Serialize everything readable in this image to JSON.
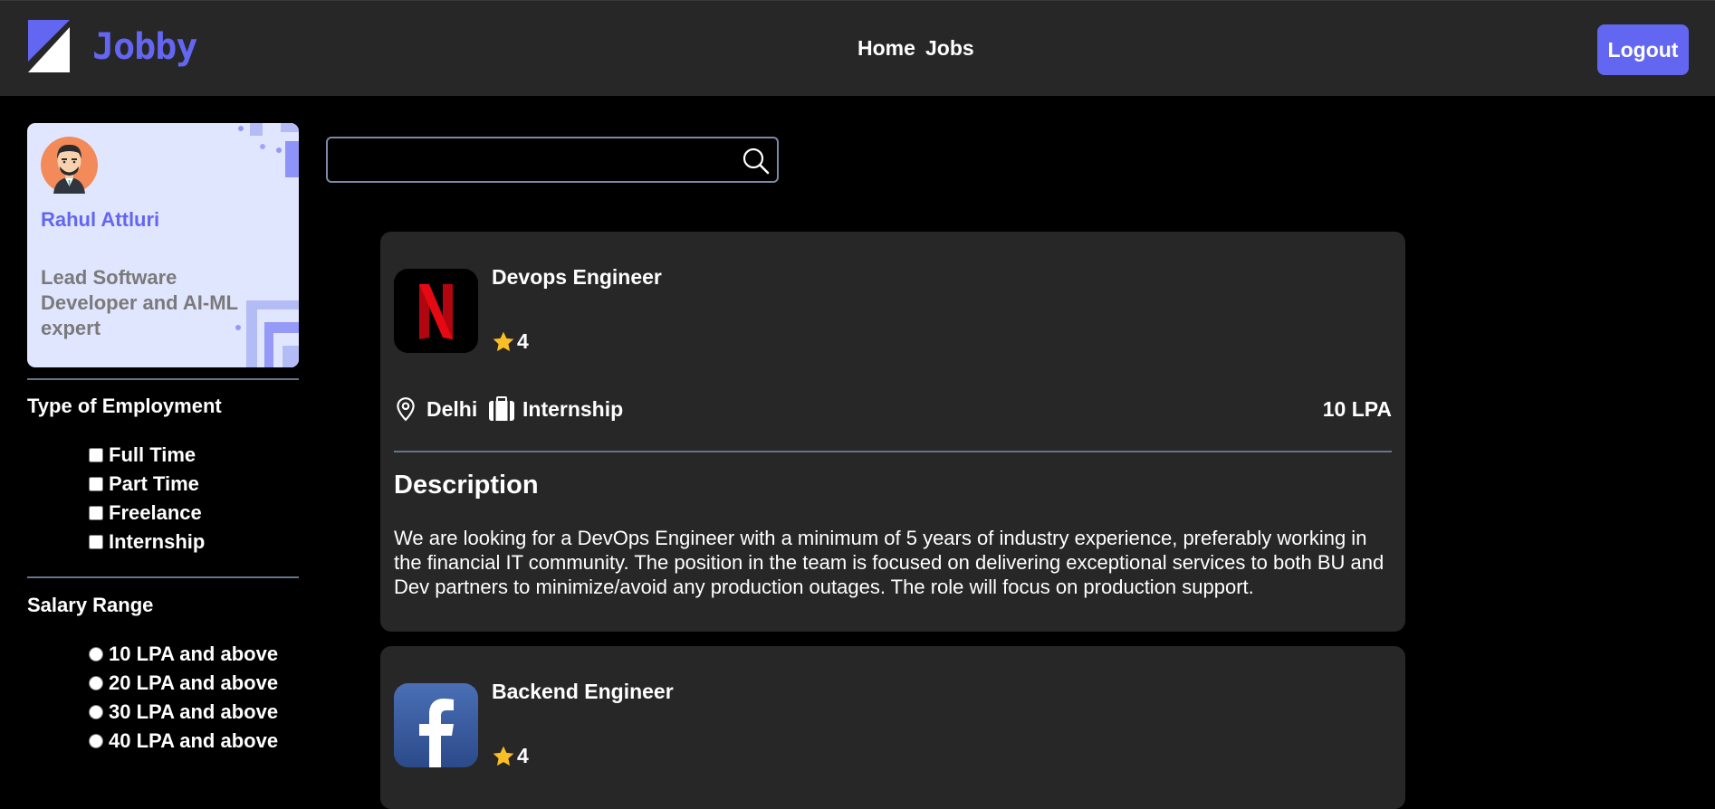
{
  "app": {
    "brand": "Jobby",
    "nav": {
      "home": "Home",
      "jobs": "Jobs"
    },
    "logout_label": "Logout",
    "accent_color": "#6366f1"
  },
  "profile": {
    "name": "Rahul Attluri",
    "bio": "Lead Software Developer and AI-ML expert"
  },
  "filters": {
    "employment_title": "Type of Employment",
    "employment_options": [
      {
        "label": "Full Time",
        "checked": false
      },
      {
        "label": "Part Time",
        "checked": false
      },
      {
        "label": "Freelance",
        "checked": false
      },
      {
        "label": "Internship",
        "checked": false
      }
    ],
    "salary_title": "Salary Range",
    "salary_options": [
      {
        "label": "10 LPA and above",
        "selected": false
      },
      {
        "label": "20 LPA and above",
        "selected": false
      },
      {
        "label": "30 LPA and above",
        "selected": false
      },
      {
        "label": "40 LPA and above",
        "selected": false
      }
    ]
  },
  "search": {
    "value": "",
    "placeholder": ""
  },
  "jobs": [
    {
      "company_logo": "netflix-logo",
      "title": "Devops Engineer",
      "rating": "4",
      "location": "Delhi",
      "employment_type": "Internship",
      "package": "10 LPA",
      "description_heading": "Description",
      "description": "We are looking for a DevOps Engineer with a minimum of 5 years of industry experience, preferably working in the financial IT community. The position in the team is focused on delivering exceptional services to both BU and Dev partners to minimize/avoid any production outages. The role will focus on production support."
    },
    {
      "company_logo": "facebook-logo",
      "title": "Backend Engineer",
      "rating": "4"
    }
  ]
}
